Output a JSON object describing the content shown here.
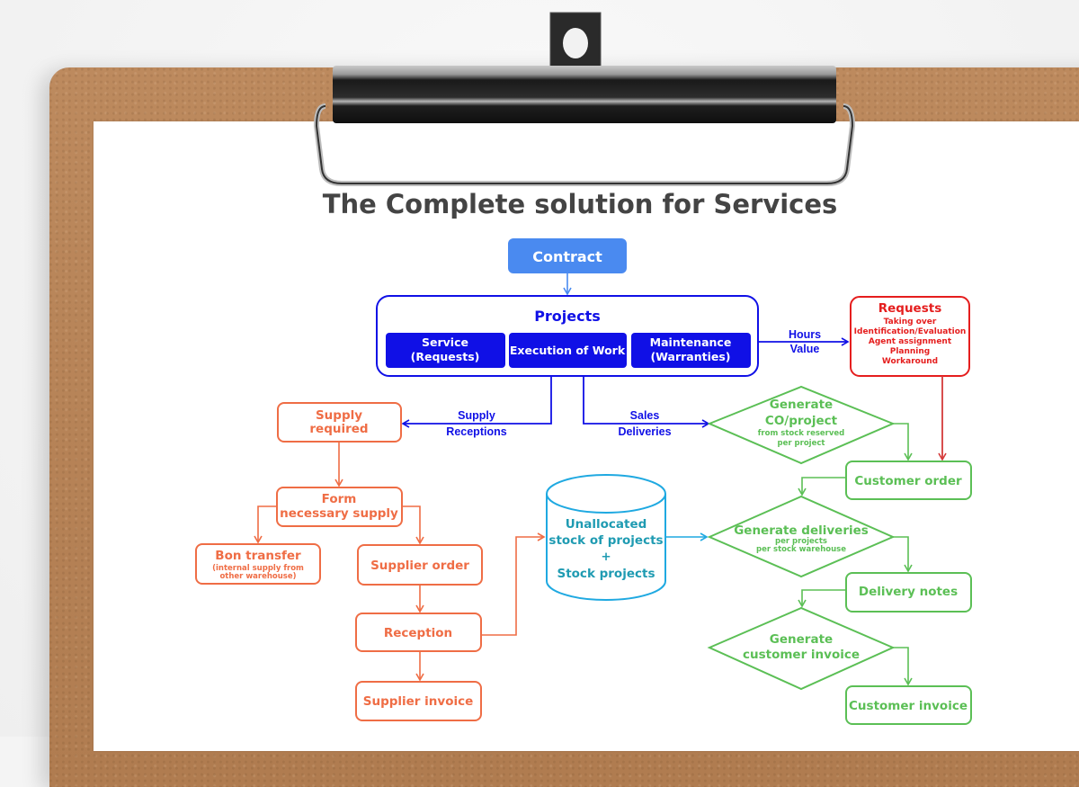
{
  "title": "The Complete solution for Services",
  "colors": {
    "contract": "#4a8af0",
    "projects": "#1010e6",
    "requests": "#e51e1e",
    "requests_arrow": "#d43a3a",
    "supply": "#ef6d45",
    "stock_stroke": "#1fa9e1",
    "stock_text": "#1f9bb2",
    "sales": "#5bbf55",
    "board": "#b98558"
  },
  "contract": {
    "label": "Contract"
  },
  "projects": {
    "label": "Projects",
    "items": [
      {
        "line1": "Service",
        "line2": "(Requests)"
      },
      {
        "line1": "Execution of Work",
        "line2": ""
      },
      {
        "line1": "Maintenance",
        "line2": "(Warranties)"
      }
    ]
  },
  "hours_value": {
    "line1": "Hours",
    "line2": "Value"
  },
  "requests": {
    "label": "Requests",
    "items": [
      "Taking over",
      "Identification/Evaluation",
      "Agent assignment",
      "Planning",
      "Workaround"
    ]
  },
  "supply_receptions": {
    "line1": "Supply",
    "line2": "Receptions"
  },
  "sales_deliveries": {
    "line1": "Sales",
    "line2": "Deliveries"
  },
  "supply_flow": {
    "supply_required": {
      "line1": "Supply",
      "line2": "required"
    },
    "form_supply": {
      "line1": "Form",
      "line2": "necessary supply"
    },
    "bon_transfer": {
      "label": "Bon transfer",
      "sub1": "(internal supply from",
      "sub2": "other warehouse)"
    },
    "supplier_order": "Supplier order",
    "reception": "Reception",
    "supplier_invoice": "Supplier invoice"
  },
  "stock": {
    "line1": "Unallocated",
    "line2": "stock of projects",
    "line3": "+",
    "line4": "Stock projects"
  },
  "sales_flow": {
    "generate_co": {
      "line1": "Generate",
      "line2": "CO/project",
      "sub1": "from stock reserved",
      "sub2": "per project"
    },
    "customer_order": "Customer order",
    "generate_deliveries": {
      "label": "Generate deliveries",
      "sub1": "per projects",
      "sub2": "per stock warehouse"
    },
    "delivery_notes": "Delivery notes",
    "generate_invoice": {
      "line1": "Generate",
      "line2": "customer invoice"
    },
    "customer_invoice": "Customer invoice"
  }
}
